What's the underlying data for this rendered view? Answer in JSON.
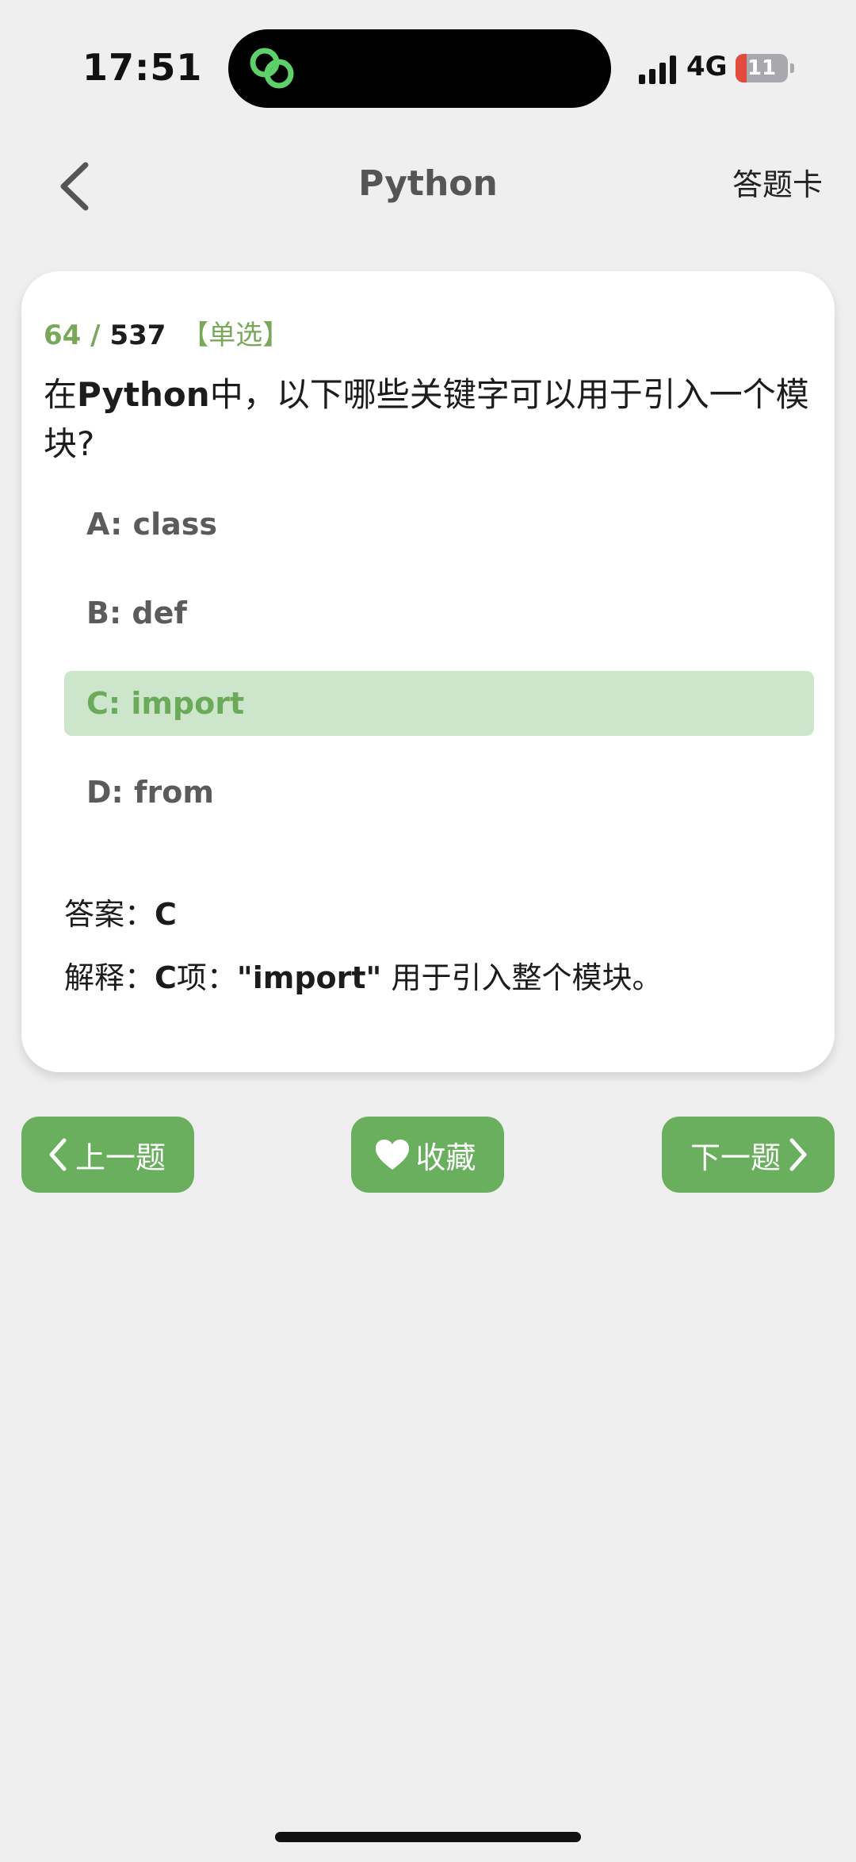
{
  "status": {
    "time": "17:51",
    "network": "4G",
    "battery": "11",
    "colors": {
      "island_icon": "#5fcf6a",
      "battery_low": "#e24b3f"
    }
  },
  "nav": {
    "title": "Python",
    "answer_card": "答题卡"
  },
  "question": {
    "current": "64",
    "separator": "/",
    "total": "537",
    "type": "【单选】",
    "text_prefix": "在",
    "text_bold": "Python",
    "text_suffix": "中，以下哪些关键字可以用于引入一个模块?",
    "options": [
      {
        "label": "A: class",
        "selected": false
      },
      {
        "label": "B: def",
        "selected": false
      },
      {
        "label": "C: import",
        "selected": true
      },
      {
        "label": "D: from",
        "selected": false
      }
    ],
    "answer_label": "答案：",
    "answer_value": "C",
    "explanation_label": "解释：",
    "explanation_bold1": "C",
    "explanation_mid": "项：",
    "explanation_bold2": "\"import\"",
    "explanation_rest": " 用于引入整个模块。"
  },
  "buttons": {
    "prev": "上一题",
    "favorite": "收藏",
    "next": "下一题"
  },
  "colors": {
    "accent": "#6aaf5e",
    "selected_bg": "#cde6cb",
    "selected_text": "#6aaa5a",
    "background": "#efeff0"
  }
}
